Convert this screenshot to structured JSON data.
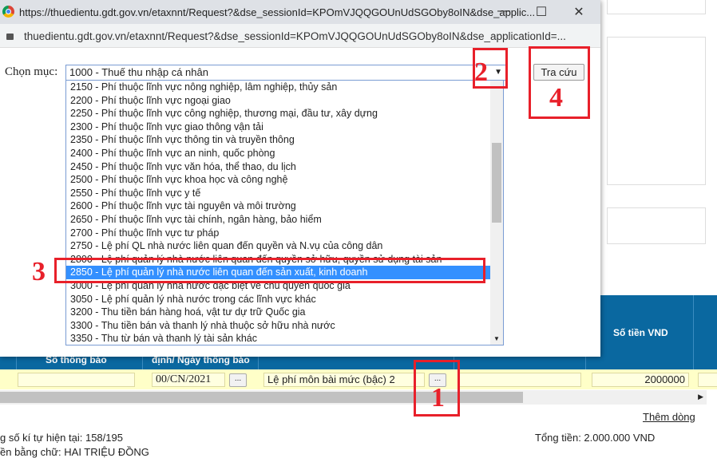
{
  "popup": {
    "title": "https://thuedientu.gdt.gov.vn/etaxnnt/Request?&dse_sessionId=KPOmVJQQGOUnUdSGOby8oIN&dse_applic...",
    "address": "thuedientu.gdt.gov.vn/etaxnnt/Request?&dse_sessionId=KPOmVJQQGOUnUdSGOby8oIN&dse_applicationId=...",
    "minimize": "—",
    "maximize": "☐",
    "close": "✕",
    "label": "Chọn mục:",
    "selected": "1000 - Thuế thu nhập cá nhân",
    "search_button": "Tra cứu",
    "options": [
      "2150 - Phí thuộc lĩnh vực nông nghiệp, lâm nghiệp, thủy sản",
      "2200 - Phí thuộc lĩnh vực ngoại giao",
      "2250 - Phí thuộc lĩnh vực công nghiệp, thương mại, đầu tư, xây dựng",
      "2300 - Phí thuộc lĩnh vực giao thông vận tải",
      "2350 - Phí thuộc lĩnh vực thông tin và truyền thông",
      "2400 - Phí thuộc lĩnh vực an ninh, quốc phòng",
      "2450 - Phí thuộc lĩnh vực văn hóa, thể thao, du lịch",
      "2500 - Phí thuộc lĩnh vực khoa học và công nghệ",
      "2550 - Phí thuộc lĩnh vực y tế",
      "2600 - Phí thuộc lĩnh vực tài nguyên và môi trường",
      "2650 - Phí thuộc lĩnh vực tài chính, ngân hàng, bảo hiểm",
      "2700 - Phí thuộc lĩnh vực tư pháp",
      "2750 - Lệ phí QL nhà nước liên quan đến quyền và N.vụ của công dân",
      "2800 - Lệ phí quản lý nhà nước liên quan đến quyền sở hữu, quyền sử dụng tài sản",
      "2850 - Lệ phí quản lý nhà nước liên quan đến sản xuất, kinh doanh",
      "3000 - Lệ phí quản lý nhà nước đặc biệt về chủ quyền quốc gia",
      "3050 - Lệ phí quản lý nhà nước trong các lĩnh vực khác",
      "3200 - Thu tiền bán hàng hoá, vật tư dự trữ Quốc gia",
      "3300 - Thu tiền bán và thanh lý nhà thuộc sở hữu nhà nước",
      "3350 - Thu từ bán và thanh lý tài sản khác"
    ],
    "highlighted_index": 14
  },
  "table": {
    "headers": [
      "Số thông báo",
      "định/ Ngày thông báo",
      "Số tiền VND"
    ],
    "row": {
      "so_thong_bao": "",
      "ngay": "00/CN/2021",
      "noi_dung": "Lệ phí môn bài mức (bậc) 2",
      "so_tien": "2000000",
      "dots": "..."
    }
  },
  "footer": {
    "add_row": "Thêm dòng",
    "char_count": "g số kí tự hiện tại: 158/195",
    "total": "Tổng tiền: 2.000.000 VND",
    "in_words": "ền bằng chữ: HAI TRIỆU ĐỒNG"
  },
  "annotations": [
    "1",
    "2",
    "3",
    "4"
  ],
  "colors": {
    "header_blue": "#0a68a0",
    "row_yellow": "#ffffc8",
    "highlight": "#3390ff",
    "annotation_red": "#e8202a"
  }
}
